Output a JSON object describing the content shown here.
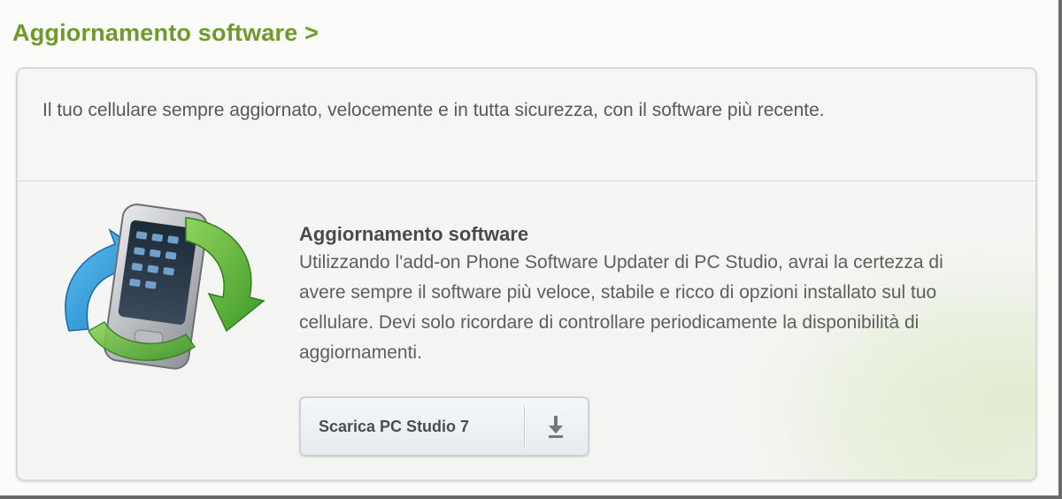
{
  "header": {
    "title": "Aggiornamento software >"
  },
  "card": {
    "intro": "Il tuo cellulare sempre aggiornato, velocemente e in tutta sicurezza, con il software più recente.",
    "feature": {
      "title": "Aggiornamento software",
      "body": "Utilizzando l'add-on Phone Software Updater di PC Studio, avrai la certezza di avere sempre il software più veloce, stabile e ricco di opzioni installato sul tuo cellulare. Devi solo ricordare di controllare periodicamente la disponibilità di aggiornamenti."
    },
    "download_button": {
      "label": "Scarica PC Studio 7",
      "icon": "download-icon"
    },
    "illustration_icon": "phone-update-icon"
  },
  "colors": {
    "title_green": "#6f9a2a",
    "arrow_blue": "#2b97d6",
    "arrow_green": "#59b43a"
  }
}
